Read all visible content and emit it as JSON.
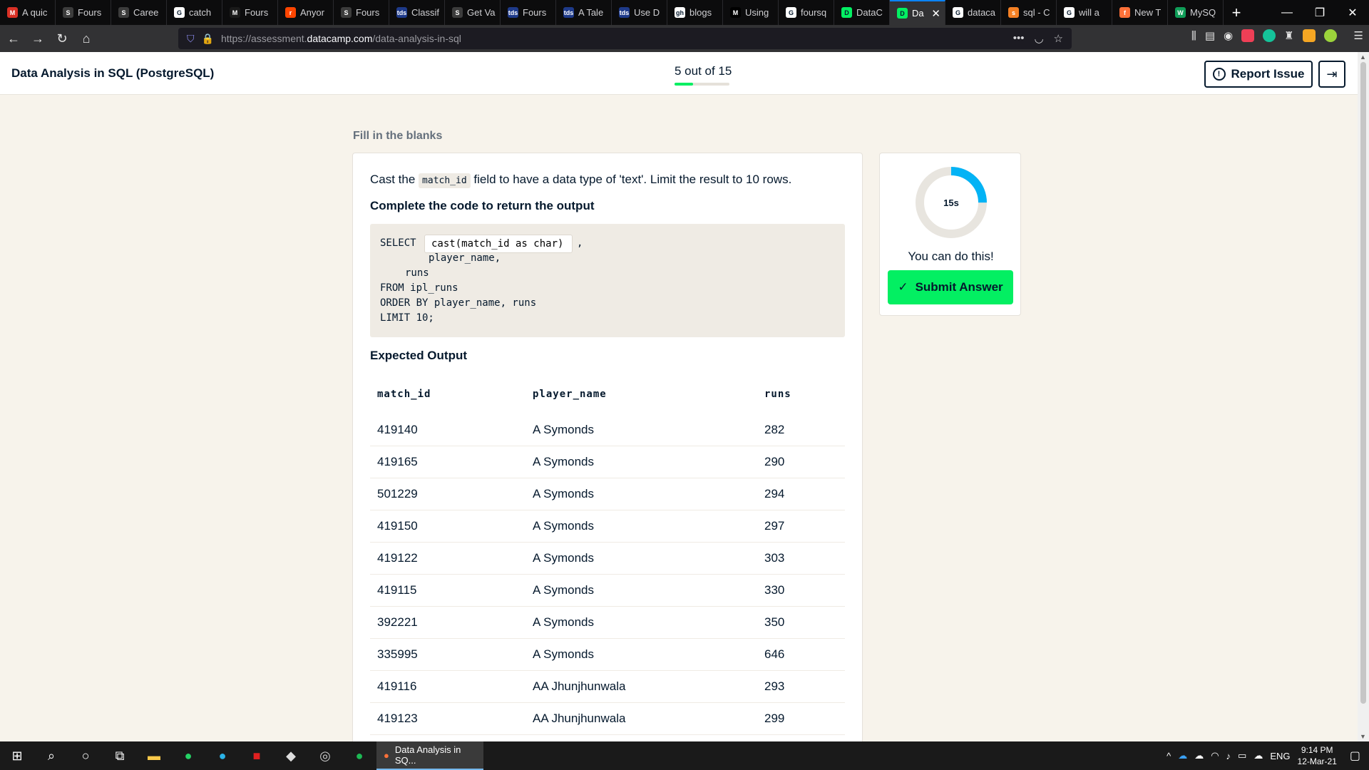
{
  "browser": {
    "tabs": [
      {
        "label": "A quic",
        "fav_color": "#d93025",
        "fav_glyph": "M"
      },
      {
        "label": "Fours",
        "fav_color": "#3c3c3c",
        "fav_glyph": "S"
      },
      {
        "label": "Caree",
        "fav_color": "#3c3c3c",
        "fav_glyph": "S"
      },
      {
        "label": "catch",
        "fav_color": "#ffffff",
        "fav_glyph": "G"
      },
      {
        "label": "Fours",
        "fav_color": "#1a1a1a",
        "fav_glyph": "M"
      },
      {
        "label": "Anyor",
        "fav_color": "#ff4500",
        "fav_glyph": "r"
      },
      {
        "label": "Fours",
        "fav_color": "#3c3c3c",
        "fav_glyph": "S"
      },
      {
        "label": "Classif",
        "fav_color": "#1e3a8a",
        "fav_glyph": "tds"
      },
      {
        "label": "Get Va",
        "fav_color": "#3c3c3c",
        "fav_glyph": "S"
      },
      {
        "label": "Fours",
        "fav_color": "#1e3a8a",
        "fav_glyph": "tds"
      },
      {
        "label": "A Tale",
        "fav_color": "#1e3a8a",
        "fav_glyph": "tds"
      },
      {
        "label": "Use D",
        "fav_color": "#1e3a8a",
        "fav_glyph": "tds"
      },
      {
        "label": "blogs",
        "fav_color": "#ffffff",
        "fav_glyph": "gh"
      },
      {
        "label": "Using",
        "fav_color": "#000000",
        "fav_glyph": "M"
      },
      {
        "label": "foursq",
        "fav_color": "#ffffff",
        "fav_glyph": "G"
      },
      {
        "label": "DataC",
        "fav_color": "#03ef62",
        "fav_glyph": "D"
      },
      {
        "label": "Da",
        "fav_color": "#03ef62",
        "fav_glyph": "D",
        "active": true
      },
      {
        "label": "dataca",
        "fav_color": "#ffffff",
        "fav_glyph": "G"
      },
      {
        "label": "sql - C",
        "fav_color": "#f48024",
        "fav_glyph": "s"
      },
      {
        "label": "will a",
        "fav_color": "#ffffff",
        "fav_glyph": "G"
      },
      {
        "label": "New T",
        "fav_color": "#ff7139",
        "fav_glyph": "f"
      },
      {
        "label": "MySQ",
        "fav_color": "#0f9d58",
        "fav_glyph": "W"
      }
    ],
    "close_glyph": "✕",
    "new_tab_glyph": "+",
    "url_prefix": "https://assessment.",
    "url_host": "datacamp.com",
    "url_path": "/data-analysis-in-sql"
  },
  "header": {
    "course_title": "Data Analysis in SQL (PostgreSQL)",
    "progress_text": "5 out of 15",
    "progress_fraction": 0.333,
    "report_label": "Report Issue"
  },
  "main": {
    "section_label": "Fill in the blanks",
    "question_pre": "Cast the ",
    "question_code": "match_id",
    "question_post": " field to have a data type of 'text'. Limit the result to 10 rows.",
    "instruction": "Complete the code to return the output",
    "code": {
      "select_kw": "SELECT",
      "blank_value": "cast(match_id as char)",
      "comma": ",",
      "line2": "player_name,",
      "line3": "runs",
      "line4": "FROM ipl_runs",
      "line5": "ORDER BY player_name, runs",
      "line6": "LIMIT 10;"
    },
    "expected_title": "Expected Output",
    "table": {
      "headers": [
        "match_id",
        "player_name",
        "runs"
      ],
      "rows": [
        [
          "419140",
          "A Symonds",
          "282"
        ],
        [
          "419165",
          "A Symonds",
          "290"
        ],
        [
          "501229",
          "A Symonds",
          "294"
        ],
        [
          "419150",
          "A Symonds",
          "297"
        ],
        [
          "419122",
          "A Symonds",
          "303"
        ],
        [
          "419115",
          "A Symonds",
          "330"
        ],
        [
          "392221",
          "A Symonds",
          "350"
        ],
        [
          "335995",
          "A Symonds",
          "646"
        ],
        [
          "419116",
          "AA Jhunjhunwala",
          "293"
        ],
        [
          "419123",
          "AA Jhunjhunwala",
          "299"
        ]
      ]
    }
  },
  "sidebar": {
    "timer_label": "15s",
    "timer_fraction": 0.25,
    "encouragement": "You can do this!",
    "submit_label": "Submit Answer"
  },
  "taskbar": {
    "app_label": "Data Analysis in SQ...",
    "language": "ENG",
    "time": "9:14 PM",
    "date": "12-Mar-21"
  },
  "colors": {
    "accent_green": "#03ef62",
    "timer_blue": "#03b3f5",
    "navy": "#05192d"
  }
}
